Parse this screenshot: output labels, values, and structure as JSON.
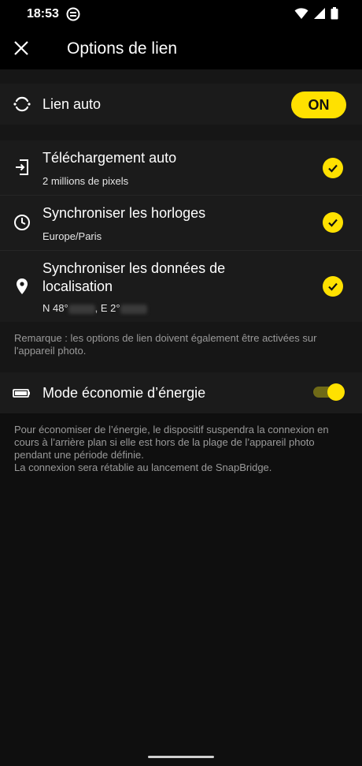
{
  "status_bar": {
    "time": "18:53"
  },
  "app_bar": {
    "title": "Options de lien"
  },
  "auto_link": {
    "label": "Lien auto",
    "state": "ON"
  },
  "settings": [
    {
      "title": "Téléchargement auto",
      "subtitle": "2 millions de pixels",
      "checked": true
    },
    {
      "title": "Synchroniser les horloges",
      "subtitle": "Europe/Paris",
      "checked": true
    },
    {
      "title": "Synchroniser les données de localisation",
      "subtitle_lat_prefix": "N 48°",
      "subtitle_lon_prefix": ", E 2°",
      "checked": true
    }
  ],
  "note_link": "Remarque : les options de lien doivent également être activées sur l'appareil photo.",
  "power_saving": {
    "label": "Mode économie d’énergie",
    "enabled": true
  },
  "note_power": "Pour économiser de l’énergie, le dispositif suspendra la connexion en cours à l’arrière plan si elle est hors de la plage de l’appareil photo pendant une période définie.\nLa connexion sera rétablie au lancement de SnapBridge.",
  "colors": {
    "accent": "#ffe100",
    "background": "#0f0f0f",
    "row": "#1b1b1b"
  }
}
